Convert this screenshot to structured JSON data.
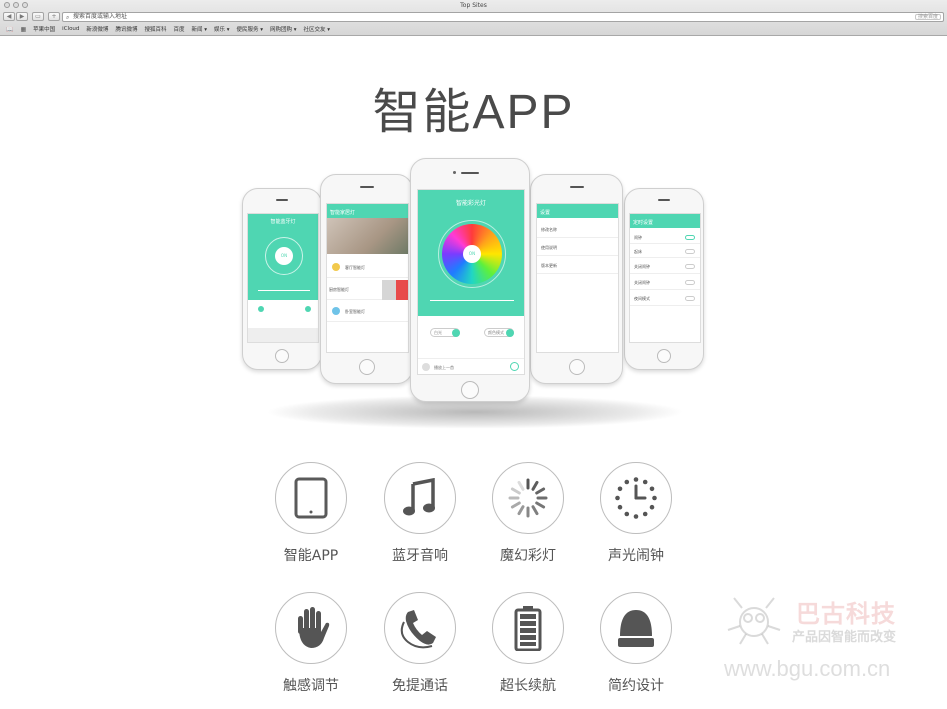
{
  "window": {
    "title": "Top Sites"
  },
  "toolbar": {
    "back": "◀",
    "forward": "▶",
    "reader": "▭",
    "add": "+",
    "url_placeholder": "搜索百度或输入地址",
    "search_button": "搜索百度"
  },
  "bookmarks": [
    "苹果中国",
    "iCloud",
    "新浪微博",
    "腾讯微博",
    "搜狐百科",
    "百度",
    "新闻 ▾",
    "娱乐 ▾",
    "便民服务 ▾",
    "网购团购 ▾",
    "社区交友 ▾"
  ],
  "page": {
    "title": "智能APP"
  },
  "phones": {
    "p1": {
      "header": "智能蓝牙灯",
      "knob": "ON"
    },
    "p2": {
      "header": "智能家居灯",
      "item1": "客厅智能灯",
      "item2": "厨房智能灯",
      "item3": "卧室智能灯"
    },
    "p3": {
      "header": "智能彩光灯",
      "knob": "ON",
      "tag1": "白光",
      "tag2": "颜色模式",
      "footer": "播放上一首"
    },
    "p4": {
      "header": "设置",
      "row1": "修改名称",
      "row2": "使用说明",
      "row3": "版本更新"
    },
    "p5": {
      "header": "定时设置",
      "rows": [
        "闹钟",
        "起床",
        "关闭闹钟",
        "关闭闹钟",
        "夜间模式"
      ]
    }
  },
  "features": [
    {
      "icon": "tablet-icon",
      "label": "智能APP"
    },
    {
      "icon": "music-note-icon",
      "label": "蓝牙音响"
    },
    {
      "icon": "spinner-icon",
      "label": "魔幻彩灯"
    },
    {
      "icon": "clock-icon",
      "label": "声光闹钟"
    },
    {
      "icon": "hand-icon",
      "label": "触感调节"
    },
    {
      "icon": "phone-icon",
      "label": "免提通话"
    },
    {
      "icon": "battery-icon",
      "label": "超长续航"
    },
    {
      "icon": "lamp-icon",
      "label": "简约设计"
    }
  ],
  "watermark": {
    "brand": "巴古科技",
    "slogan": "产品因智能而改变",
    "url": "www.bgu.com.cn"
  },
  "colors": {
    "accent": "#4fd6b2",
    "text": "#555555"
  }
}
